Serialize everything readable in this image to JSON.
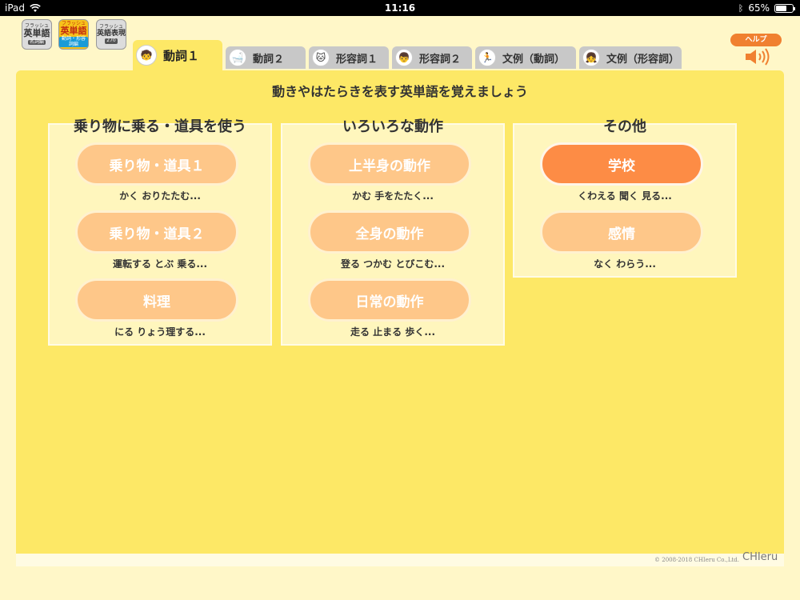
{
  "status": {
    "device": "iPad",
    "time": "11:16",
    "battery": "65%",
    "battery_level": 0.65
  },
  "app_icons": [
    {
      "top": "フラッシュ",
      "main": "英単語",
      "sub": "名詞編"
    },
    {
      "top": "フラッシュ",
      "main": "英単語",
      "sub": "動詞・形容詞編"
    },
    {
      "top": "フラッシュ",
      "main": "英語表現",
      "sub": "270"
    }
  ],
  "tabs": [
    {
      "label": "動詞１",
      "icon": "student-icon",
      "active": true
    },
    {
      "label": "動詞２",
      "icon": "bath-icon"
    },
    {
      "label": "形容詞１",
      "icon": "character-icon"
    },
    {
      "label": "形容詞２",
      "icon": "person-icon"
    },
    {
      "label": "文例（動詞）",
      "icon": "runner-icon"
    },
    {
      "label": "文例（形容詞）",
      "icon": "girl-icon"
    }
  ],
  "help": {
    "label": "ヘルプ",
    "speaker": "speaker-icon"
  },
  "page_title": "動きやはたらきを表す英単語を覚えましょう",
  "sections": [
    {
      "title": "乗り物に乗る・道具を使う",
      "items": [
        {
          "label": "乗り物・道具１",
          "desc": "かく おりたたむ..."
        },
        {
          "label": "乗り物・道具２",
          "desc": "運転する とぶ 乗る..."
        },
        {
          "label": "料理",
          "desc": "にる りょう理する..."
        }
      ]
    },
    {
      "title": "いろいろな動作",
      "items": [
        {
          "label": "上半身の動作",
          "desc": "かむ 手をたたく..."
        },
        {
          "label": "全身の動作",
          "desc": "登る つかむ とびこむ..."
        },
        {
          "label": "日常の動作",
          "desc": "走る 止まる 歩く..."
        }
      ]
    },
    {
      "title": "その他",
      "items": [
        {
          "label": "学校",
          "desc": "くわえる 聞く 見る...",
          "active": true
        },
        {
          "label": "感情",
          "desc": "なく わらう..."
        }
      ]
    }
  ],
  "footer": {
    "copyright": "© 2008-2018 CHIeru Co.,Ltd.",
    "logo": "CHIeru"
  },
  "colors": {
    "panel": "#fde866",
    "pill": "#fec789",
    "pill_active": "#fd8c45",
    "tab_inactive": "#c8c8c8",
    "help": "#f08030"
  }
}
